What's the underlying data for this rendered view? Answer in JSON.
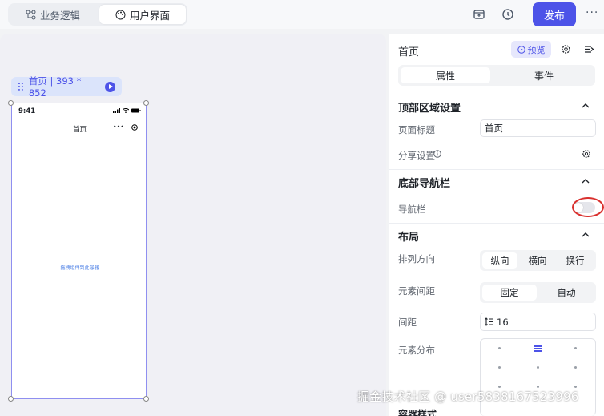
{
  "topbar": {
    "tab_logic": "业务逻辑",
    "tab_ui": "用户界面",
    "publish": "发布",
    "more": "···"
  },
  "canvas": {
    "page_chip": "首页 | 393 * 852",
    "phone": {
      "time": "9:41",
      "title": "首页",
      "placeholder": "拖拽组件到此容器"
    }
  },
  "panel": {
    "title": "首页",
    "preview": "预览",
    "tabs": [
      "属性",
      "事件"
    ],
    "sections": {
      "top": "顶部区域设置",
      "bottom_nav": "底部导航栏",
      "layout": "布局",
      "container": "容器样式"
    },
    "fields": {
      "page_title_label": "页面标题",
      "page_title_value": "首页",
      "share_label": "分享设置",
      "nav_label": "导航栏",
      "direction_label": "排列方向",
      "direction_options": [
        "纵向",
        "横向",
        "换行"
      ],
      "spacing_mode_label": "元素间距",
      "spacing_mode_options": [
        "固定",
        "自动"
      ],
      "gap_label": "间距",
      "gap_value": "16",
      "distribution_label": "元素分布"
    },
    "nav_enabled": false
  },
  "watermark": "掘金技术社区 @ user5838167523996",
  "colors": {
    "accent": "#4d53e8",
    "highlight_ring": "#d9302e"
  }
}
